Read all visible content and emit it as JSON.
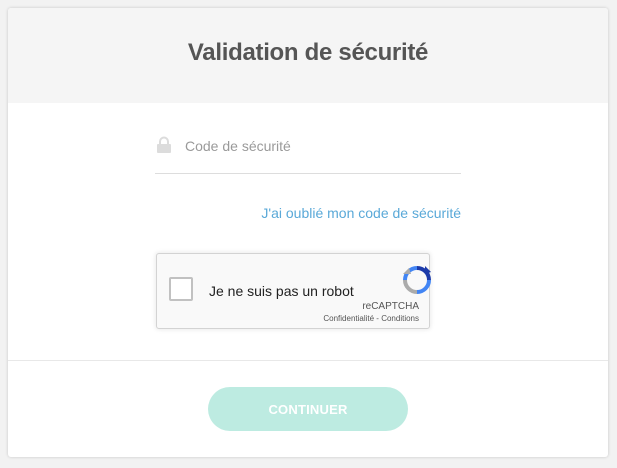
{
  "header": {
    "title": "Validation de sécurité"
  },
  "form": {
    "security_code": {
      "placeholder": "Code de sécurité",
      "value": "",
      "icon": "lock-icon"
    },
    "forgot_link": "J'ai oublié mon code de sécurité"
  },
  "recaptcha": {
    "label": "Je ne suis pas un robot",
    "brand": "reCAPTCHA",
    "privacy": "Confidentialité",
    "separator": " - ",
    "terms": "Conditions",
    "checked": false,
    "icon": "recaptcha-logo-icon"
  },
  "footer": {
    "continue_label": "CONTINUER"
  },
  "colors": {
    "background": "#f2f2f2",
    "header_bg": "#f5f5f5",
    "title": "#555555",
    "link": "#5aa9d8",
    "button_bg": "#bdebe1",
    "button_text": "#ffffff"
  }
}
